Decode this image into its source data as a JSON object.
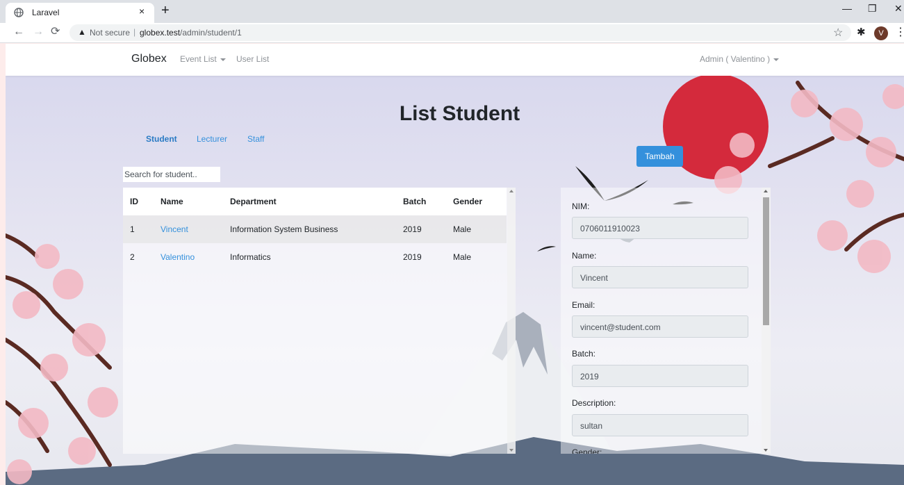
{
  "browser": {
    "tab_title": "Laravel",
    "tab_close": "×",
    "new_tab": "+",
    "security_label": "Not secure",
    "separator": "|",
    "url_host": "globex.test",
    "url_path": "/admin/student/1",
    "profile_initial": "V"
  },
  "navbar": {
    "brand": "Globex",
    "event_list": "Event List",
    "user_list": "User List",
    "admin": "Admin ( Valentino )"
  },
  "main": {
    "title": "List Student",
    "tabs": [
      "Student",
      "Lecturer",
      "Staff"
    ],
    "search_placeholder": "Search for student..",
    "add_button": "Tambah"
  },
  "table": {
    "headers": [
      "ID",
      "Name",
      "Department",
      "Batch",
      "Gender"
    ],
    "rows": [
      [
        "1",
        "Vincent",
        "Information System Business",
        "2019",
        "Male"
      ],
      [
        "2",
        "Valentino",
        "Informatics",
        "2019",
        "Male"
      ]
    ]
  },
  "detail": {
    "nim_label": "NIM:",
    "nim": "0706011910023",
    "name_label": "Name:",
    "name": "Vincent",
    "email_label": "Email:",
    "email": "vincent@student.com",
    "batch_label": "Batch:",
    "batch": "2019",
    "description_label": "Description:",
    "description": "sultan",
    "gender_label": "Gender:"
  },
  "colors": {
    "accent": "#3490dc",
    "sun": "#d42a3c",
    "mountain": "#5b6b82"
  },
  "icons": [
    "globe-icon",
    "back-icon",
    "forward-icon",
    "reload-icon",
    "warning-icon",
    "star-icon",
    "puzzle-icon",
    "menu-icon",
    "caret-down-icon"
  ]
}
